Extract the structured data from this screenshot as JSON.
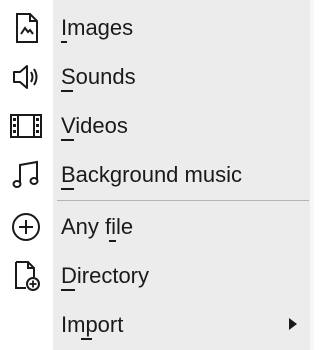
{
  "menu": {
    "items": [
      {
        "label": "Images",
        "icon": "image-file-icon",
        "mnemonic": "I"
      },
      {
        "label": "Sounds",
        "icon": "speaker-icon",
        "mnemonic": "S"
      },
      {
        "label": "Videos",
        "icon": "film-strip-icon",
        "mnemonic": "V"
      },
      {
        "label": "Background music",
        "icon": "music-note-icon",
        "mnemonic": "B"
      },
      {
        "label": "Any file",
        "icon": "plus-circle-icon",
        "mnemonic": "f"
      },
      {
        "label": "Directory",
        "icon": "folder-add-icon",
        "mnemonic": "D"
      },
      {
        "label": "Import",
        "icon": "",
        "mnemonic": "p",
        "has_submenu": true
      }
    ]
  }
}
